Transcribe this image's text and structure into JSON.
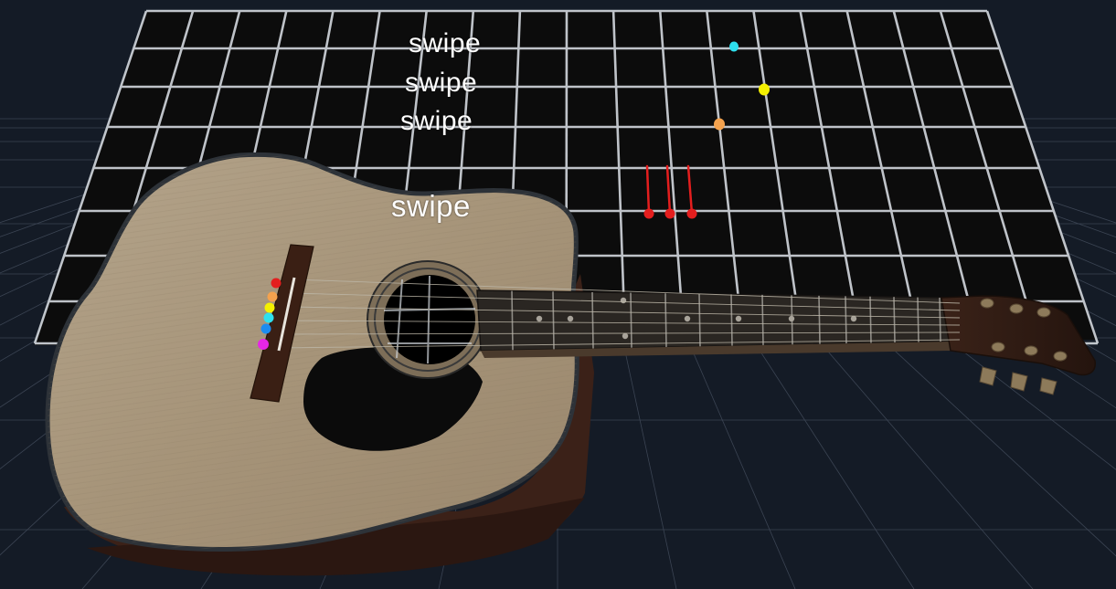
{
  "prompts": {
    "swipe_1": "swipe",
    "swipe_2": "swipe",
    "swipe_3": "swipe",
    "swipe_4": "swipe"
  },
  "markers": {
    "top": [
      "cyan",
      "yellow",
      "orange"
    ],
    "strum": [
      "red",
      "red",
      "red"
    ],
    "bridge_notes": [
      "red",
      "orange",
      "yellow",
      "cyan",
      "blue",
      "magenta"
    ]
  },
  "colors": {
    "background": "#141b26",
    "floor_grid": "#5b6678",
    "board": "#0c0c0c",
    "board_grid": "#dfe4ea",
    "body_wood": "#a8967d",
    "body_edge": "#2d3238",
    "body_side": "#3b2118",
    "soundhole": "#000000",
    "fretboard": "#2a2622",
    "cyan": "#2ee0ee",
    "yellow": "#f4f000",
    "orange": "#f4a24e",
    "red": "#e41e1e",
    "blue": "#1c8cf0",
    "magenta": "#e626e6"
  }
}
